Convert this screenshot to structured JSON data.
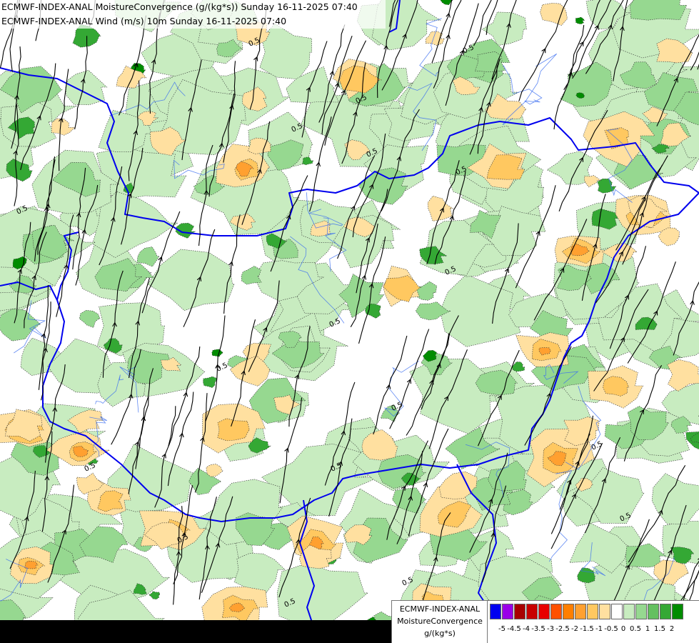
{
  "header": {
    "line1": "ECMWF-INDEX-ANAL MoistureConvergence (g/(kg*s)) Sunday 16-11-2025 07:40",
    "line2": "ECMWF-INDEX-ANAL Wind (m/s) 10m Sunday 16-11-2025 07:40"
  },
  "legend": {
    "title_line1": "ECMWF-INDEX-ANAL",
    "title_line2": "MoistureConvergence",
    "title_line3": "g/(kg*s)",
    "colors": [
      "#0000f0",
      "#9a00e8",
      "#a80000",
      "#c80000",
      "#e80000",
      "#ff5000",
      "#ff7f00",
      "#ffa030",
      "#ffc860",
      "#ffe0a0",
      "#ffffff",
      "#c8ecc0",
      "#96d890",
      "#64c060",
      "#34a834",
      "#008c00"
    ],
    "ticks": [
      "-5",
      "-4.5",
      "-4",
      "-3.5",
      "-3",
      "-2.5",
      "-2",
      "-1.5",
      "-1",
      "-0.5",
      "0",
      "0.5",
      "1",
      "1.5",
      "2"
    ]
  },
  "contour_label": "0.5",
  "colors": {
    "border": "#0000ee",
    "river": "#3a6df0",
    "streamline": "#000000"
  }
}
